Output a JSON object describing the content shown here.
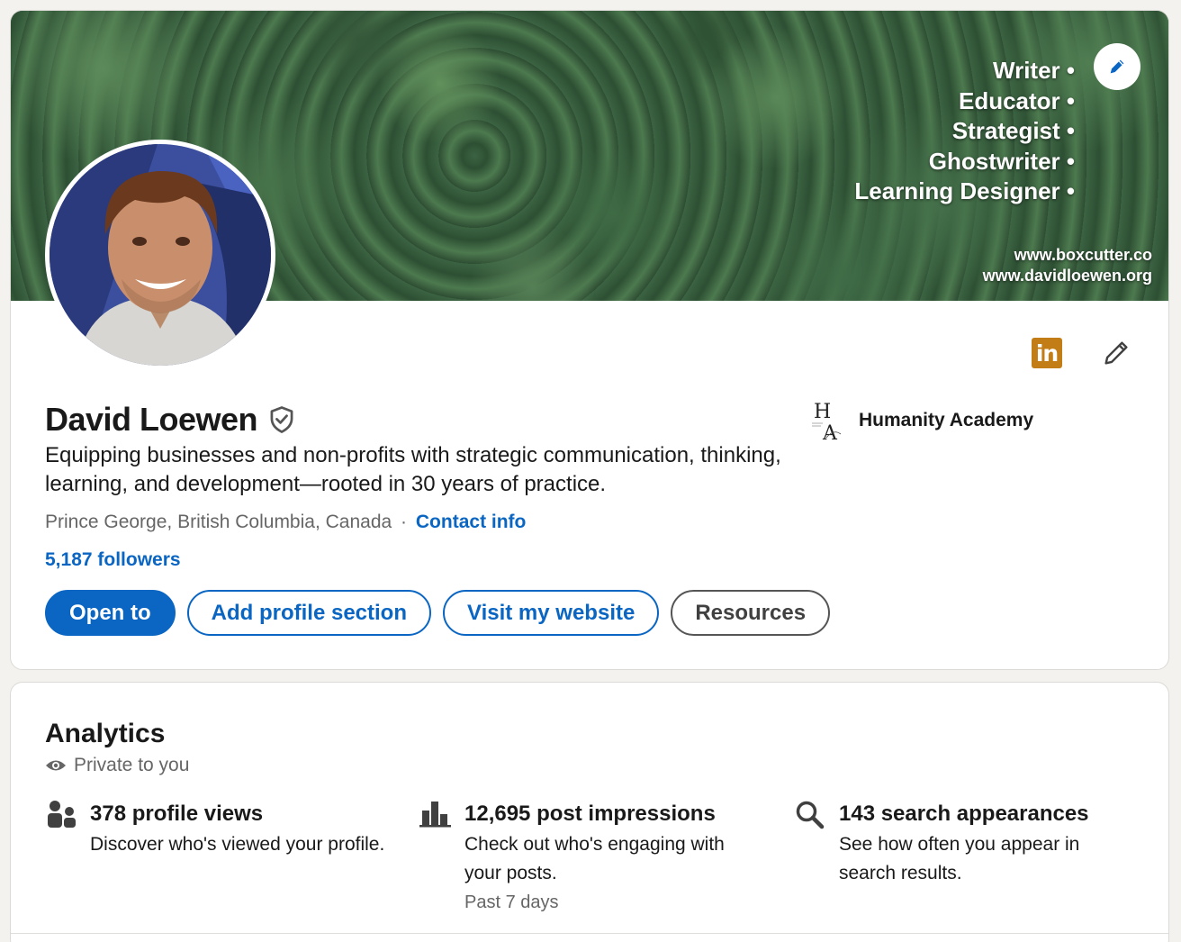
{
  "banner": {
    "words": [
      "Writer",
      "Educator",
      "Strategist",
      "Ghostwriter",
      "Learning Designer"
    ],
    "urls": [
      "www.boxcutter.co",
      "www.davidloewen.org"
    ]
  },
  "profile": {
    "name": "David Loewen",
    "headline": "Equipping businesses and non-profits with strategic communication, thinking, learning, and development—rooted in 30 years of practice.",
    "location": "Prince George, British Columbia, Canada",
    "separator": "·",
    "contact_info": "Contact info",
    "followers": "5,187 followers",
    "organization": "Humanity Academy",
    "linkedin_badge": "in"
  },
  "actions": {
    "open_to": "Open to",
    "add_section": "Add profile section",
    "visit_website": "Visit my website",
    "resources": "Resources"
  },
  "analytics": {
    "title": "Analytics",
    "privacy": "Private to you",
    "metrics": [
      {
        "icon": "people-icon",
        "title": "378 profile views",
        "desc": "Discover who's viewed your profile.",
        "sub": ""
      },
      {
        "icon": "bar-chart-icon",
        "title": "12,695 post impressions",
        "desc": "Check out who's engaging with your posts.",
        "sub": "Past 7 days"
      },
      {
        "icon": "search-icon",
        "title": "143 search appearances",
        "desc": "See how often you appear in search results.",
        "sub": ""
      }
    ]
  },
  "colors": {
    "accent": "#0a66c2",
    "linkedin_badge": "#c37d16",
    "page_bg": "#f4f2ee"
  }
}
